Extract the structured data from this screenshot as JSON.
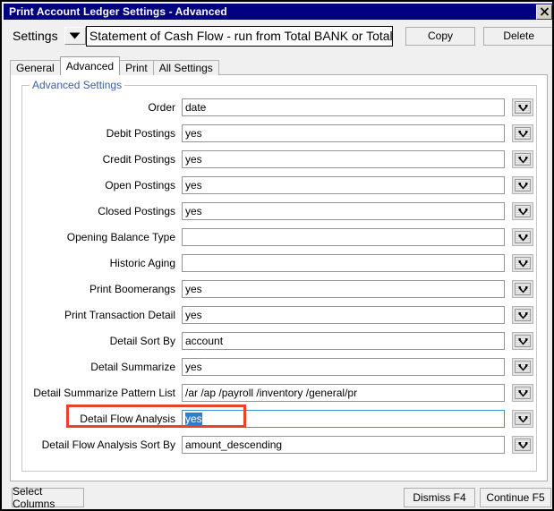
{
  "window": {
    "title": "Print Account Ledger Settings - Advanced",
    "close_icon": "close-icon",
    "titlebar_color": "#000080"
  },
  "header": {
    "settings_label": "Settings",
    "settings_dropdown_icon": "chevron-down-icon",
    "settings_value": "Statement of Cash Flow - run from Total BANK or Total CASH",
    "copy_label": "Copy",
    "delete_label": "Delete"
  },
  "tabs": [
    {
      "label": "General",
      "active": false
    },
    {
      "label": "Advanced",
      "active": true
    },
    {
      "label": "Print",
      "active": false
    },
    {
      "label": "All Settings",
      "active": false
    }
  ],
  "group": {
    "title": "Advanced Settings",
    "title_color": "#3b5ea8"
  },
  "fields": [
    {
      "label": "Order",
      "value": "date",
      "dropdown_icon": "chevron-down-icon"
    },
    {
      "label": "Debit Postings",
      "value": "yes",
      "dropdown_icon": "chevron-down-icon"
    },
    {
      "label": "Credit Postings",
      "value": "yes",
      "dropdown_icon": "chevron-down-icon"
    },
    {
      "label": "Open Postings",
      "value": "yes",
      "dropdown_icon": "chevron-down-icon"
    },
    {
      "label": "Closed Postings",
      "value": "yes",
      "dropdown_icon": "chevron-down-icon"
    },
    {
      "label": "Opening Balance Type",
      "value": "",
      "dropdown_icon": "chevron-down-icon"
    },
    {
      "label": "Historic Aging",
      "value": "",
      "dropdown_icon": "chevron-down-icon"
    },
    {
      "label": "Print Boomerangs",
      "value": "yes",
      "dropdown_icon": "chevron-down-icon"
    },
    {
      "label": "Print Transaction Detail",
      "value": "yes",
      "dropdown_icon": "chevron-down-icon"
    },
    {
      "label": "Detail Sort By",
      "value": "account",
      "dropdown_icon": "chevron-down-icon"
    },
    {
      "label": "Detail Summarize",
      "value": "yes",
      "dropdown_icon": "chevron-down-icon"
    },
    {
      "label": "Detail Summarize Pattern List",
      "value": "/ar /ap /payroll /inventory  /general/pr",
      "dropdown_icon": "chevron-down-icon"
    },
    {
      "label": "Detail Flow Analysis",
      "value": "yes",
      "dropdown_icon": "chevron-down-icon",
      "focused": true,
      "selected_text": true,
      "highlighted": true
    },
    {
      "label": "Detail Flow Analysis Sort By",
      "value": "amount_descending",
      "dropdown_icon": "chevron-down-icon"
    }
  ],
  "annotation": {
    "color": "#e8412c",
    "target_field": "Detail Flow Analysis"
  },
  "footer": {
    "select_columns_label": "Select Columns",
    "dismiss_label": "Dismiss F4",
    "continue_label": "Continue F5"
  }
}
